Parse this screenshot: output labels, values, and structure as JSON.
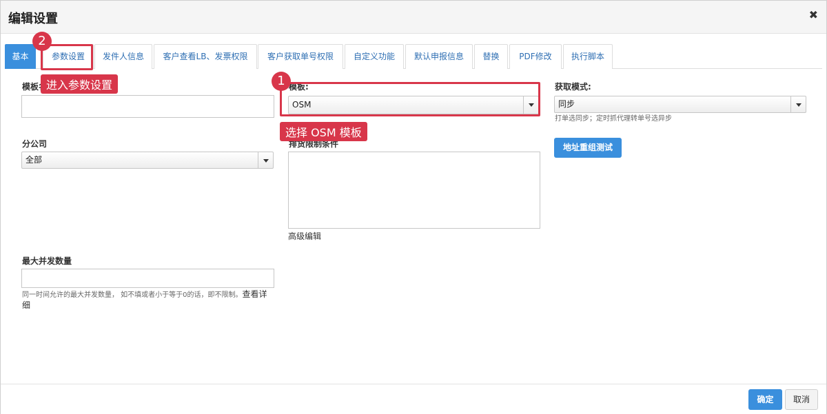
{
  "dialog": {
    "title": "编辑设置",
    "close_symbol": "✖"
  },
  "tabs": [
    {
      "label": "基本"
    },
    {
      "label": "参数设置"
    },
    {
      "label": "发件人信息"
    },
    {
      "label": "客户查看LB、发票权限"
    },
    {
      "label": "客户获取单号权限"
    },
    {
      "label": "自定义功能"
    },
    {
      "label": "默认申报信息"
    },
    {
      "label": "替换"
    },
    {
      "label": "PDF修改"
    },
    {
      "label": "执行脚本"
    }
  ],
  "form": {
    "template_name_label": "模板名",
    "template_label": "模板:",
    "template_value": "OSM",
    "fetch_mode_label": "获取模式:",
    "fetch_mode_value": "同步",
    "fetch_mode_hint": "打单选同步；定时抓代理转单号选异步",
    "address_test_button": "地址重组测试",
    "branch_label": "分公司",
    "branch_value": "全部",
    "exclude_label": "排货限制条件",
    "advanced_edit": "高级编辑",
    "max_concurrency_label": "最大并发数量",
    "max_concurrency_hint": "同一时间允许的最大并发数量， 如不填或者小于等于0的话，即不限制。",
    "view_detail_link": "查看详细"
  },
  "annotations": {
    "badge_1": "1",
    "badge_2": "2",
    "callout_1": "选择 OSM 模板",
    "callout_2": "进入参数设置",
    "color": "#d8364a"
  },
  "footer": {
    "confirm_label": "确定",
    "cancel_label": "取消"
  }
}
